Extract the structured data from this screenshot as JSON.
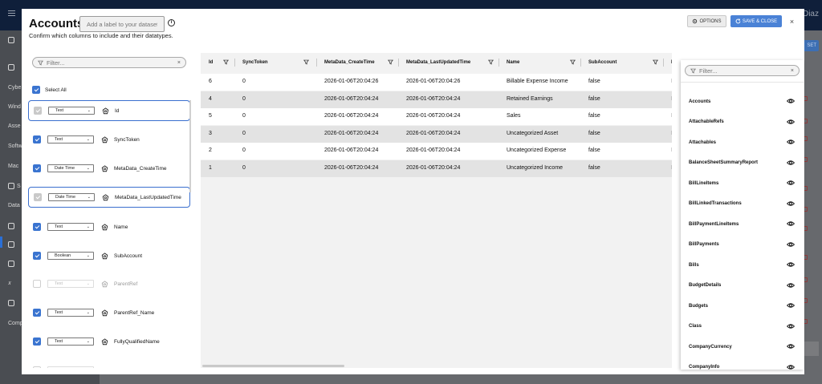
{
  "background": {
    "user_name_fragment": "Diaz",
    "sidebar_items": [
      "Cybe",
      "Wind",
      "Asse",
      "Softw",
      "Mac",
      "S",
      "Data",
      "Comp"
    ],
    "button_fragment": "SET"
  },
  "modal": {
    "title": "Accounts",
    "label_placeholder": "Add a label to your dataset",
    "subtitle": "Confirm which columns to include and their datatypes.",
    "options_label": "OPTIONS",
    "save_label": "SAVE & CLOSE",
    "close_label": "×"
  },
  "column_config": {
    "filter_placeholder": "Filter...",
    "select_all_label": "Select All",
    "columns": [
      {
        "type": "Text",
        "name": "Id",
        "state": "disabled",
        "selected": true
      },
      {
        "type": "Text",
        "name": "SyncToken",
        "state": "checked",
        "selected": false
      },
      {
        "type": "Date Time",
        "name": "MetaData_CreateTime",
        "state": "checked",
        "selected": false
      },
      {
        "type": "Date Time",
        "name": "MetaData_LastUpdatedTime",
        "state": "disabled",
        "selected": true
      },
      {
        "type": "Text",
        "name": "Name",
        "state": "checked",
        "selected": false
      },
      {
        "type": "Boolean",
        "name": "SubAccount",
        "state": "checked",
        "selected": false
      },
      {
        "type": "Text",
        "name": "ParentRef",
        "state": "unchecked",
        "selected": false
      },
      {
        "type": "Text",
        "name": "ParentRef_Name",
        "state": "checked",
        "selected": false
      },
      {
        "type": "Text",
        "name": "FullyQualifiedName",
        "state": "checked",
        "selected": false
      },
      {
        "type": "",
        "name": "",
        "state": "unchecked",
        "selected": false
      }
    ]
  },
  "preview_table": {
    "headers": [
      "Id",
      "SyncToken",
      "MetaData_CreateTime",
      "MetaData_LastUpdatedTime",
      "Name",
      "SubAccount",
      "P"
    ],
    "rows": [
      [
        "6",
        "0",
        "2026-01-06T20:04:26",
        "2026-01-06T20:04:26",
        "Billable Expense Income",
        "false",
        "N"
      ],
      [
        "4",
        "0",
        "2026-01-06T20:04:24",
        "2026-01-06T20:04:24",
        "Retained Earnings",
        "false",
        "N"
      ],
      [
        "5",
        "0",
        "2026-01-06T20:04:24",
        "2026-01-06T20:04:24",
        "Sales",
        "false",
        "N"
      ],
      [
        "3",
        "0",
        "2026-01-06T20:04:24",
        "2026-01-06T20:04:24",
        "Uncategorized Asset",
        "false",
        "N"
      ],
      [
        "2",
        "0",
        "2026-01-06T20:04:24",
        "2026-01-06T20:04:24",
        "Uncategorized Expense",
        "false",
        "N"
      ],
      [
        "1",
        "0",
        "2026-01-06T20:04:24",
        "2026-01-06T20:04:24",
        "Uncategorized Income",
        "false",
        "N"
      ]
    ]
  },
  "table_selector": {
    "filter_placeholder": "Filter...",
    "tables": [
      "Accounts",
      "AttachableRefs",
      "Attachables",
      "BalanceSheetSummaryReport",
      "BillLineItems",
      "BillLinkedTransactions",
      "BillPaymentLineItems",
      "BillPayments",
      "Bills",
      "BudgetDetails",
      "Budgets",
      "Class",
      "CompanyCurrency",
      "CompanyInfo"
    ]
  },
  "colors": {
    "accent": "#3a74d0",
    "save_button": "#4a82d6",
    "topbar": "#0f1f3a",
    "overlay": "#5f6266"
  }
}
